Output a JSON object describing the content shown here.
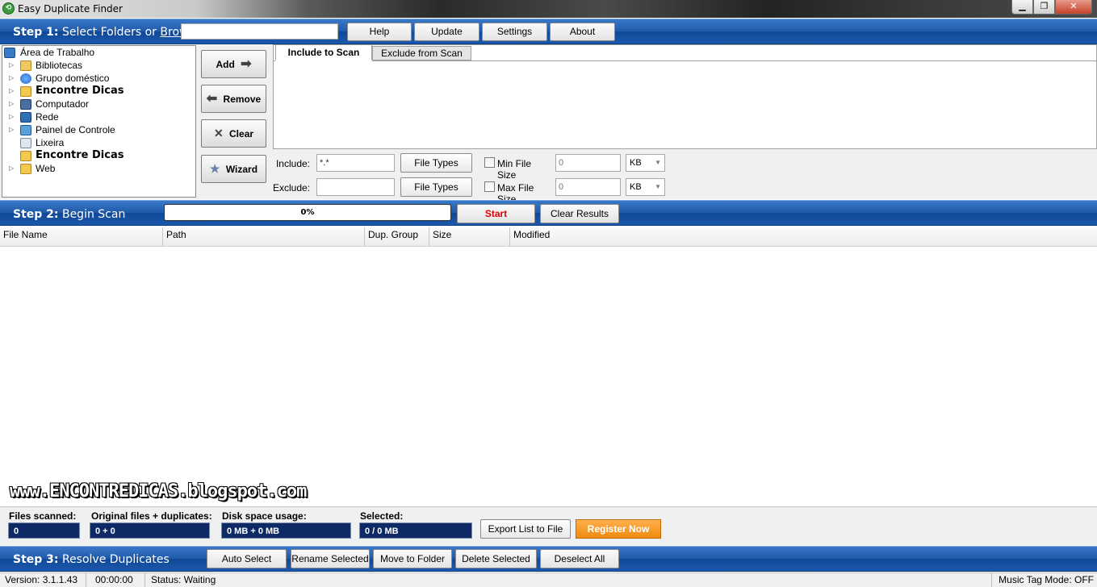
{
  "window": {
    "title": "Easy Duplicate Finder"
  },
  "step1": {
    "label_bold": "Step 1:",
    "label_text": "Select Folders or",
    "browse_link": "Browse",
    "browse_input_value": "",
    "menu": {
      "help": "Help",
      "update": "Update",
      "settings": "Settings",
      "about": "About"
    }
  },
  "tree": [
    {
      "label": "Área de Trabalho",
      "icon": "desktop-icon",
      "big": false,
      "arrow": false,
      "root": true
    },
    {
      "label": "Bibliotecas",
      "icon": "libraries-icon",
      "big": false,
      "arrow": true
    },
    {
      "label": "Grupo doméstico",
      "icon": "homegroup-icon",
      "big": false,
      "arrow": true
    },
    {
      "label": "Encontre Dicas",
      "icon": "user-folder-icon",
      "big": true,
      "arrow": true
    },
    {
      "label": "Computador",
      "icon": "computer-icon",
      "big": false,
      "arrow": true
    },
    {
      "label": "Rede",
      "icon": "network-icon",
      "big": false,
      "arrow": true
    },
    {
      "label": "Painel de Controle",
      "icon": "control-panel-icon",
      "big": false,
      "arrow": true
    },
    {
      "label": "Lixeira",
      "icon": "recycle-bin-icon",
      "big": false,
      "arrow": false
    },
    {
      "label": "Encontre Dicas",
      "icon": "folder-icon",
      "big": true,
      "arrow": false
    },
    {
      "label": "Web",
      "icon": "folder-icon",
      "big": false,
      "arrow": true
    }
  ],
  "side_buttons": {
    "add": "Add",
    "remove": "Remove",
    "clear": "Clear",
    "wizard": "Wizard"
  },
  "tabs": {
    "include": "Include to Scan",
    "exclude": "Exclude from Scan"
  },
  "filters": {
    "include_label": "Include:",
    "include_value": "*.*",
    "exclude_label": "Exclude:",
    "exclude_value": "",
    "file_types": "File Types",
    "min_size_label": "Min File Size",
    "min_size_value": "0",
    "max_size_label": "Max File Size",
    "max_size_value": "0",
    "unit": "KB"
  },
  "step2": {
    "label_bold": "Step 2:",
    "label_text": "Begin Scan",
    "progress": "0%",
    "start": "Start",
    "clear_results": "Clear Results"
  },
  "grid": {
    "columns": [
      "File Name",
      "Path",
      "Dup. Group",
      "Size",
      "Modified"
    ]
  },
  "watermark": "www.ENCONTREDICAS.blogspot.com",
  "stats": {
    "files_scanned_label": "Files scanned:",
    "files_scanned_value": "0",
    "original_label": "Original files + duplicates:",
    "original_value": "0 + 0",
    "disk_label": "Disk space usage:",
    "disk_value": "0 MB + 0 MB",
    "selected_label": "Selected:",
    "selected_value": "0 / 0 MB",
    "export": "Export List to File",
    "register": "Register Now"
  },
  "step3": {
    "label_bold": "Step 3:",
    "label_text": "Resolve Duplicates",
    "auto_select": "Auto Select",
    "rename_selected": "Rename Selected",
    "move_to_folder": "Move to Folder",
    "delete_selected": "Delete Selected",
    "deselect_all": "Deselect All"
  },
  "statusbar": {
    "version": "Version: 3.1.1.43",
    "time": "00:00:00",
    "status": "Status: Waiting",
    "music_tag": "Music Tag Mode: OFF"
  },
  "colors": {
    "step_bar": "#1f5aa9",
    "stat_value_bg": "#0e2a66",
    "register": "#f08a10",
    "start_text": "#e00000"
  }
}
